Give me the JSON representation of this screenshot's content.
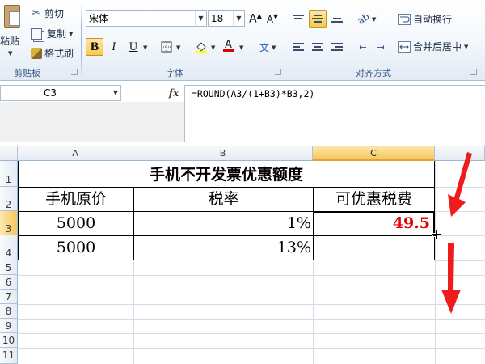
{
  "ribbon": {
    "clipboard": {
      "paste": "粘贴",
      "cut": "剪切",
      "copy": "复制",
      "format_painter": "格式刷",
      "group_label": "剪贴板"
    },
    "font": {
      "font_name": "宋体",
      "font_size": "18",
      "bold": "B",
      "italic": "I",
      "underline": "U",
      "group_label": "字体"
    },
    "alignment": {
      "wrap_text": "自动换行",
      "merge_center": "合并后居中",
      "group_label": "对齐方式"
    }
  },
  "formula_bar": {
    "name_box": "C3",
    "fx": "fx",
    "formula": "=ROUND(A3/(1+B3)*B3,2)"
  },
  "sheet": {
    "columns": [
      "A",
      "B",
      "C"
    ],
    "selected_column": "C",
    "rows": [
      "1",
      "2",
      "3",
      "4",
      "5",
      "6",
      "7",
      "8",
      "9",
      "10",
      "11"
    ],
    "selected_row": "3",
    "title": "手机不开发票优惠额度",
    "headers": [
      "手机原价",
      "税率",
      "可优惠税费"
    ],
    "data": [
      {
        "a": "5000",
        "b": "1%",
        "c": "49.5"
      },
      {
        "a": "5000",
        "b": "13%",
        "c": ""
      }
    ]
  },
  "colors": {
    "selection_header": "#f6c660",
    "result_text": "#e00000",
    "arrow_red": "#ee1c1c"
  }
}
